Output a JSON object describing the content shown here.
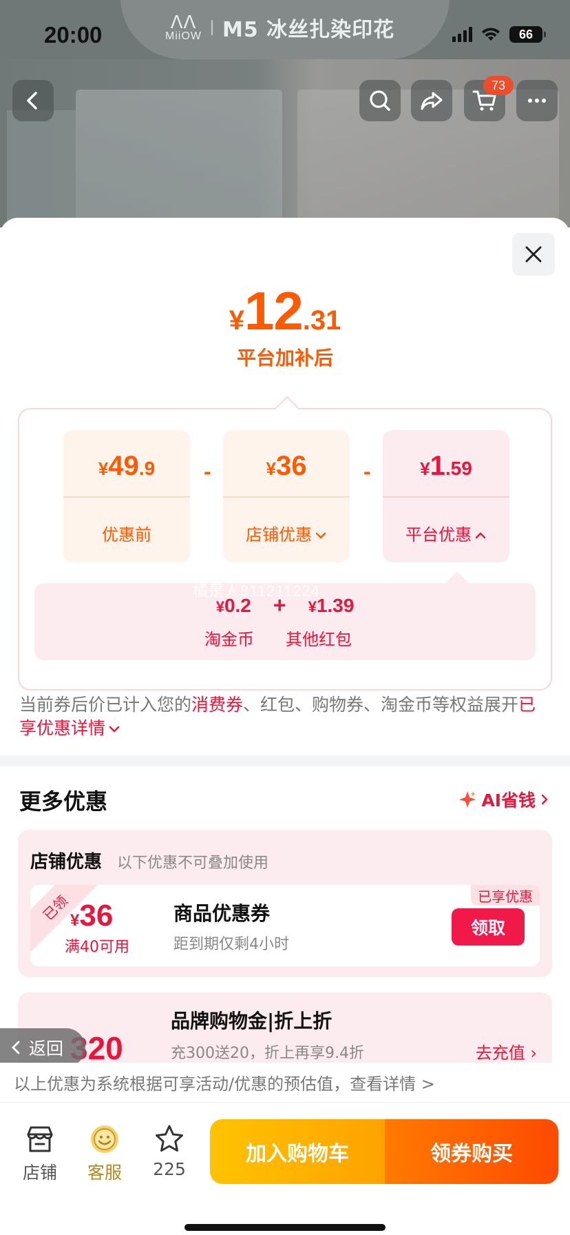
{
  "status_bar": {
    "time": "20:00",
    "battery": "66"
  },
  "product_header": {
    "logo": "MiiOW",
    "title": "M5 冰丝扎染印花"
  },
  "nav": {
    "cart_count": "73"
  },
  "summary": {
    "currency": "¥",
    "final_int": "12",
    "final_dec": ".31",
    "caption": "平台加补后"
  },
  "breakdown": {
    "original": {
      "currency": "¥",
      "int": "49",
      "dec": ".9",
      "label": "优惠前"
    },
    "store": {
      "currency": "¥",
      "int": "36",
      "dec": "",
      "label": "店铺优惠"
    },
    "platform": {
      "currency": "¥",
      "int": "1",
      "dec": ".59",
      "label": "平台优惠"
    },
    "minus": "-",
    "platform_detail": {
      "coin_currency": "¥",
      "coin_value": "0.2",
      "coin_label": "淘金币",
      "plus": "+",
      "redpack_currency": "¥",
      "redpack_value": "1.39",
      "redpack_label": "其他红包"
    },
    "watermark": "橘是人811211224"
  },
  "notice": {
    "part1": "当前券后价已计入您的",
    "highlight1": "消费券",
    "part2": "、红包、购物券、淘金币等权益展开",
    "link": "已享优惠详情"
  },
  "more_offers": {
    "title": "更多优惠",
    "ai_link": "AI省钱",
    "shop_section": {
      "title": "店铺优惠",
      "subtitle": "以下优惠不可叠加使用",
      "coupon": {
        "ribbon": "已领",
        "currency": "¥",
        "amount": "36",
        "condition": "满40可用",
        "name": "商品优惠券",
        "expiry": "距到期仅剩4小时",
        "status": "已享优惠",
        "button": "领取"
      }
    },
    "brand_card": {
      "amount": "320",
      "name": "品牌购物金|折上折",
      "subtitle": "充300送20，折上再享9.4折",
      "action": "去充值"
    }
  },
  "back_pill": "返回",
  "disclaimer": "以上优惠为系统根据可享活动/优惠的预估值，查看详情 >",
  "bottom_bar": {
    "store_label": "店铺",
    "service_label": "客服",
    "fav_count": "225",
    "add_cart": "加入购物车",
    "buy": "领券购买"
  },
  "colors": {
    "accent_orange": "#ff5a00",
    "accent_red": "#e8163d"
  }
}
